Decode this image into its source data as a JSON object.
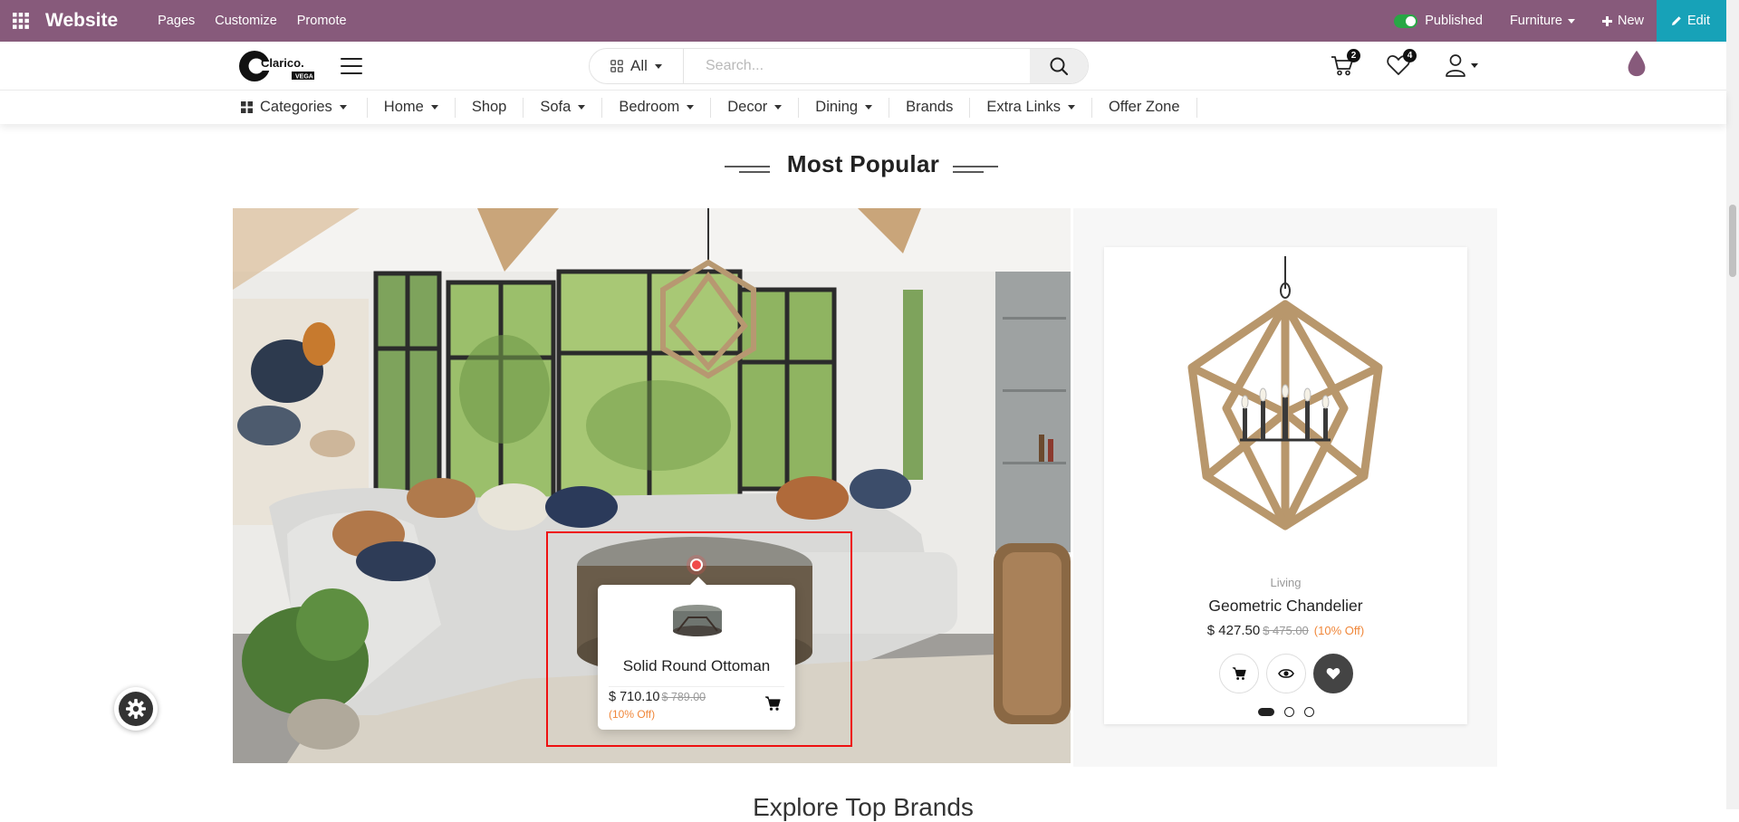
{
  "odoo_bar": {
    "brand": "Website",
    "menus": [
      "Pages",
      "Customize",
      "Promote"
    ],
    "published": "Published",
    "site": "Furniture",
    "new": "New",
    "edit": "Edit",
    "accent": "#875a7b",
    "edit_color": "#17a2b8"
  },
  "header": {
    "search_category": "All",
    "search_placeholder": "Search...",
    "cart_count": "2",
    "wishlist_count": "4"
  },
  "nav": {
    "items": [
      {
        "label": "Categories",
        "dropdown": true
      },
      {
        "label": "Home",
        "dropdown": true
      },
      {
        "label": "Shop",
        "dropdown": false
      },
      {
        "label": "Sofa",
        "dropdown": true
      },
      {
        "label": "Bedroom",
        "dropdown": true
      },
      {
        "label": "Decor",
        "dropdown": true
      },
      {
        "label": "Dining",
        "dropdown": true
      },
      {
        "label": "Brands",
        "dropdown": false
      },
      {
        "label": "Extra Links",
        "dropdown": true
      },
      {
        "label": "Offer Zone",
        "dropdown": false
      }
    ]
  },
  "section": {
    "title": "Most Popular",
    "next_title": "Explore Top Brands"
  },
  "hotspot": {
    "name": "Solid Round Ottoman",
    "price": "$ 710.10",
    "old_price": "$ 789.00",
    "discount": "(10% Off)"
  },
  "product": {
    "category": "Living",
    "name": "Geometric Chandelier",
    "price": "$ 427.50",
    "old_price": "$ 475.00",
    "discount": "(10% Off)"
  },
  "carousel": {
    "slides": 3,
    "active": 1
  }
}
